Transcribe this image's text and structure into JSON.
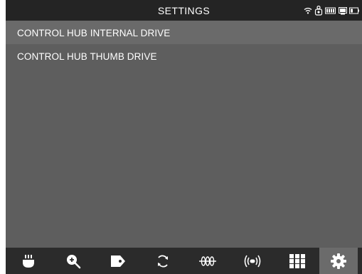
{
  "header": {
    "title": "SETTINGS",
    "status_icons": [
      "wifi-icon",
      "bluetooth-icon",
      "battery-icon",
      "drive-icon",
      "battery-small-icon"
    ]
  },
  "list": {
    "items": [
      {
        "label": "CONTROL HUB INTERNAL DRIVE"
      },
      {
        "label": "CONTROL HUB THUMB DRIVE"
      }
    ]
  },
  "bottom_nav": {
    "items": [
      {
        "icon": "sensor-icon"
      },
      {
        "icon": "zoom-in-icon"
      },
      {
        "icon": "tag-icon"
      },
      {
        "icon": "refresh-icon"
      },
      {
        "icon": "wave-icon"
      },
      {
        "icon": "signal-icon"
      },
      {
        "icon": "grid-icon"
      },
      {
        "icon": "gear-icon",
        "active": true
      }
    ]
  },
  "colors": {
    "background": "#5e5e5e",
    "header": "#242424",
    "selected_row": "#6a6a6a",
    "nav_bar": "#2b2b2b",
    "nav_active": "#6b6b6b",
    "text": "#ffffff"
  }
}
